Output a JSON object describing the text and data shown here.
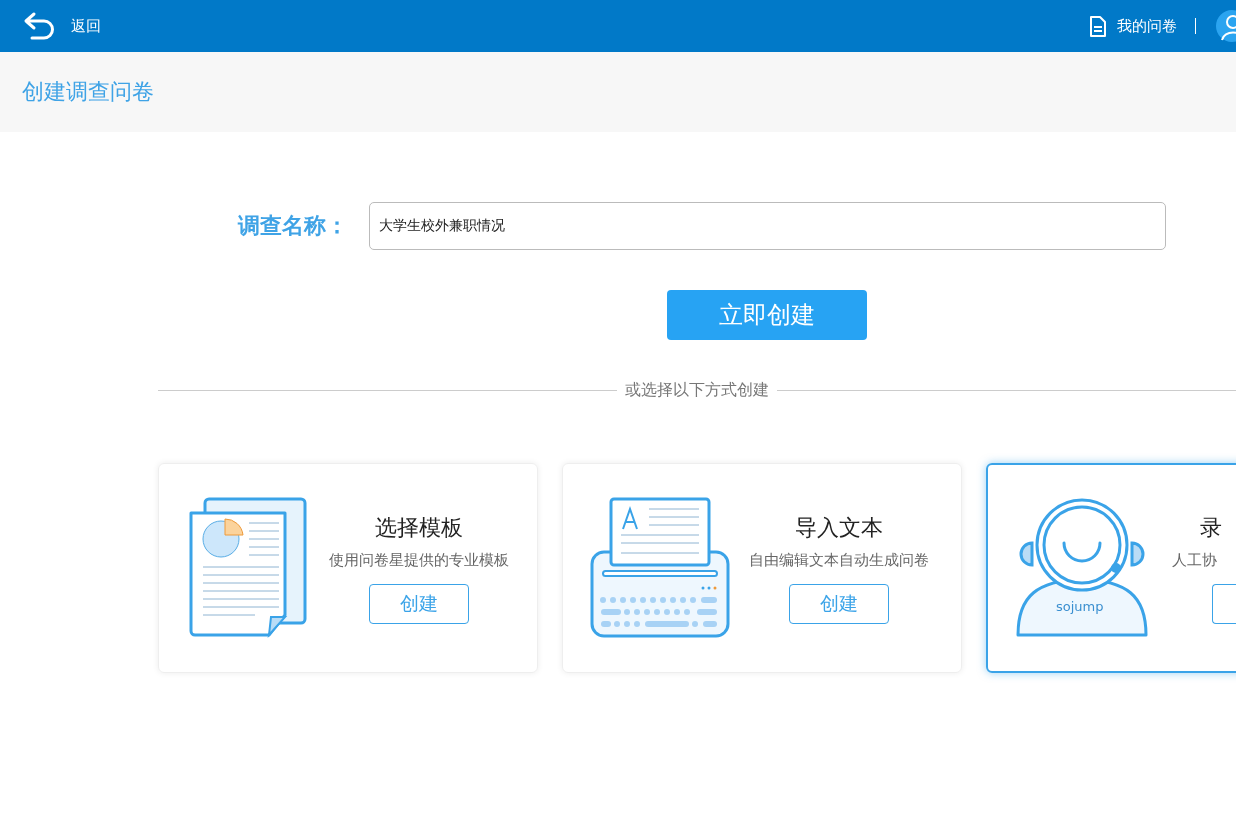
{
  "top_bar": {
    "back": "返回",
    "my_surveys": "我的问卷"
  },
  "page_title": "创建调查问卷",
  "form": {
    "label": "调查名称：",
    "value": "大学生校外兼职情况",
    "submit": "立即创建"
  },
  "divider_text": "或选择以下方式创建",
  "cards": [
    {
      "kind": "template",
      "title": "选择模板",
      "description": "使用问卷星提供的专业模板",
      "button": "创建",
      "selected": false
    },
    {
      "kind": "import",
      "title": "导入文本",
      "description": "自由编辑文本自动生成问卷",
      "button": "创建",
      "selected": false
    },
    {
      "kind": "service",
      "title": "录",
      "description": "人工协",
      "icon_label": "sojump",
      "button_cut": true,
      "selected": true
    }
  ]
}
